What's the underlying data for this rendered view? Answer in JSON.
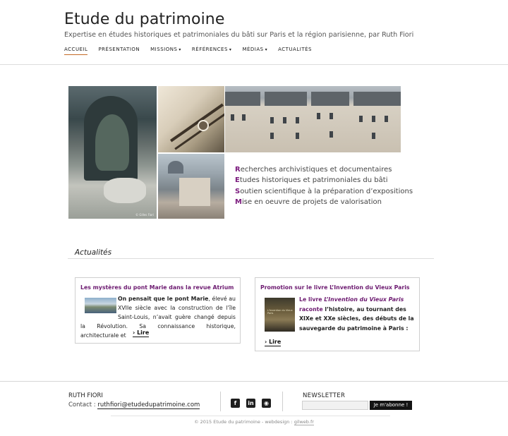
{
  "header": {
    "title": "Etude du patrimoine",
    "tagline": "Expertise en études historiques et patrimoniales du bâti sur Paris et la région parisienne, par Ruth Fiori"
  },
  "nav": {
    "items": [
      {
        "label": "ACCUEIL"
      },
      {
        "label": "PRÉSENTATION"
      },
      {
        "label": "MISSIONS"
      },
      {
        "label": "RÉFÉRENCES"
      },
      {
        "label": "MÉDIAS"
      },
      {
        "label": "ACTUALITÉS"
      }
    ],
    "caret": "▾"
  },
  "hero": {
    "photo_credit": "© Gilles Fiori",
    "services": [
      {
        "initial": "R",
        "rest": "echerches archivistiques et documentaires"
      },
      {
        "initial": "E",
        "rest": "tudes historiques et patrimoniales du bâti"
      },
      {
        "initial": "S",
        "rest": "outien scientifique à la préparation d’expositions"
      },
      {
        "initial": "M",
        "rest": "ise en oeuvre de projets de valorisation"
      }
    ],
    "accent_color": "#7b1b7e"
  },
  "news": {
    "heading": "Actualités",
    "cards": [
      {
        "title": "Les mystères du pont Marie dans la revue Atrium",
        "lead": "On pensait que le pont Marie",
        "body": ", élevé au XVIIe siècle avec la construction de l’île Saint-Louis, n’avait guère changé depuis la Révolution. Sa connaissance historique, architecturale et",
        "read_more": "› Lire"
      },
      {
        "title": "Promotion sur le livre L’Invention du Vieux Paris",
        "pre": "Le livre ",
        "book_title": "L’Invention du Vieux Paris",
        "post": " raconte",
        "body": "l’histoire, au tournant des XIXe  et XXe siècles, des débuts de la sauvegarde du patrimoine à Paris :",
        "read_more": "› Lire",
        "book_cover_text": "L'Invention du Vieux Paris"
      }
    ]
  },
  "footer": {
    "name": "RUTH FIORI",
    "contact_label": "Contact : ",
    "email": "ruthfiori@etudedupatrimoine.com",
    "social": [
      {
        "icon": "facebook-icon",
        "glyph": "f"
      },
      {
        "icon": "linkedin-icon",
        "glyph": "in"
      },
      {
        "icon": "rss-icon",
        "glyph": "◉"
      }
    ],
    "newsletter_title": "NEWSLETTER",
    "newsletter_placeholder": "",
    "newsletter_button": "Je m'abonne !",
    "copyright": "© 2015 Etude du patrimoine - webdesign : ",
    "credit": "gilweb.fr"
  }
}
